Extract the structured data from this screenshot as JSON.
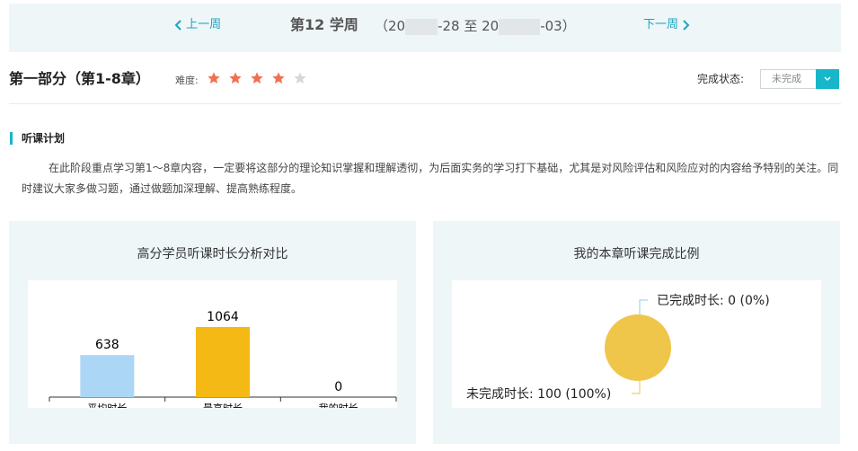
{
  "week_nav": {
    "prev_label": "上一周",
    "next_label": "下一周",
    "title": "第12 学周",
    "range_prefix": "（20",
    "range_mid": "-28 至 20",
    "range_suffix": "-03）"
  },
  "section": {
    "title": "第一部分（第1-8章）",
    "difficulty_label": "难度:",
    "difficulty_stars": 4,
    "difficulty_max": 5,
    "status_label": "完成状态:",
    "status_value": "未完成"
  },
  "plan": {
    "title": "听课计划",
    "text": "在此阶段重点学习第1～8章内容，一定要将这部分的理论知识掌握和理解透彻，为后面实务的学习打下基础，尤其是对风险评估和风险应对的内容给予特别的关注。同时建议大家多做习题，通过做题加深理解、提高熟练程度。"
  },
  "colors": {
    "accent": "#17b6c9",
    "star_on": "#f2704f",
    "star_off": "#d8d8d8",
    "bar_avg": "#acd6f5",
    "bar_max": "#f5b915",
    "pie": "#efc54a"
  },
  "chart_data": [
    {
      "type": "bar",
      "title": "高分学员听课时长分析对比",
      "categories": [
        "平均时长",
        "最高时长",
        "我的时长"
      ],
      "values": [
        638,
        1064,
        0
      ],
      "data_labels": [
        "638",
        "1064",
        "0"
      ],
      "xlabel": "",
      "ylabel": "",
      "grid": false
    },
    {
      "type": "pie",
      "title": "我的本章听课完成比例",
      "slices": [
        {
          "label": "已完成时长: 0 (0%)",
          "value": 0
        },
        {
          "label": "未完成时长: 100 (100%)",
          "value": 100
        }
      ]
    }
  ]
}
